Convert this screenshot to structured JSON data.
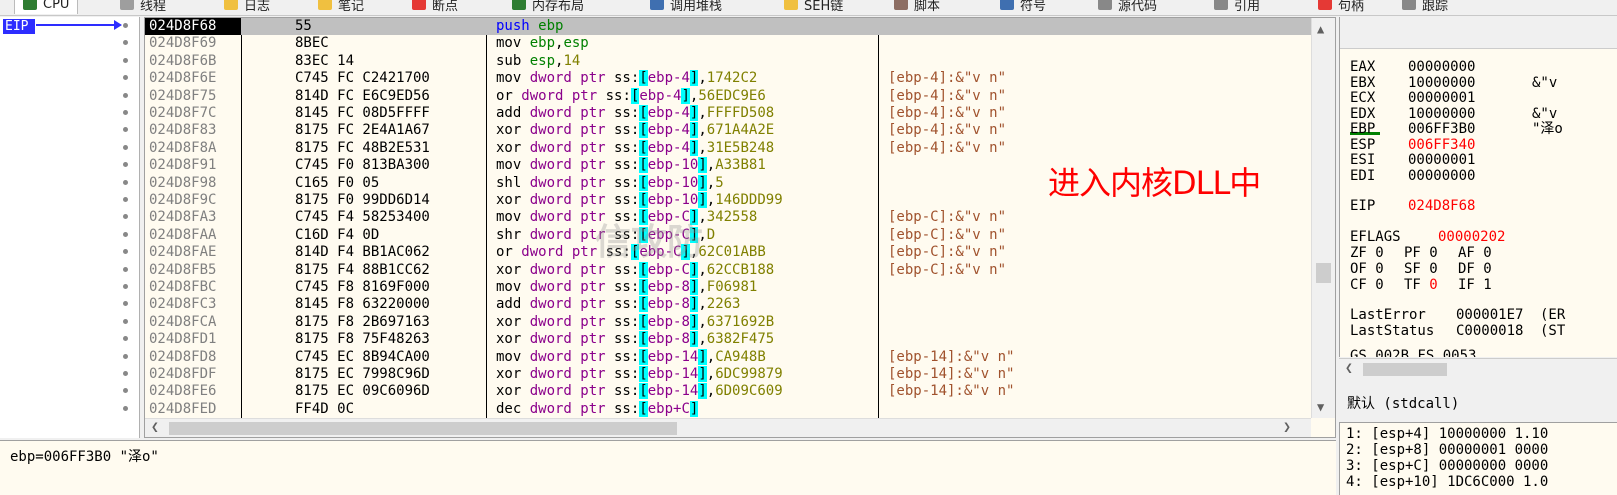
{
  "tabs": [
    {
      "label": "CPU",
      "active": true,
      "icon": "cpu-icon",
      "color": "#2e7d32"
    },
    {
      "label": "线程",
      "icon": "thread-icon",
      "color": "#9e9e9e"
    },
    {
      "label": "日志",
      "icon": "log-icon",
      "color": "#f0c040"
    },
    {
      "label": "笔记",
      "icon": "notes-icon",
      "color": "#f0c040"
    },
    {
      "label": "断点",
      "icon": "breakpoint-icon",
      "color": "#e53935"
    },
    {
      "label": "内存布局",
      "icon": "memory-map-icon",
      "color": "#2e7d32"
    },
    {
      "label": "调用堆栈",
      "icon": "call-stack-icon",
      "color": "#3f6fb0"
    },
    {
      "label": "SEH链",
      "icon": "seh-icon",
      "color": "#f0c040"
    },
    {
      "label": "脚本",
      "icon": "script-icon",
      "color": "#8d6e63"
    },
    {
      "label": "符号",
      "icon": "symbols-icon",
      "color": "#3f6fb0"
    },
    {
      "label": "源代码",
      "icon": "source-icon",
      "color": "#888888"
    },
    {
      "label": "引用",
      "icon": "references-icon",
      "color": "#888888"
    },
    {
      "label": "句柄",
      "icon": "handles-icon",
      "color": "#e53935"
    },
    {
      "label": "跟踪",
      "icon": "trace-icon",
      "color": "#888888"
    }
  ],
  "gutter": {
    "eip_label": "EIP"
  },
  "disasm": {
    "rows": [
      {
        "addr": "024D8F68",
        "bytes": "55",
        "ins": [
          [
            "push",
            "k-push"
          ],
          [
            " ",
            ""
          ],
          [
            "ebp",
            "k-reg"
          ]
        ],
        "comment": ""
      },
      {
        "addr": "024D8F69",
        "bytes": "8BEC",
        "ins": [
          [
            "mov ",
            ""
          ],
          [
            "ebp",
            "k-reg"
          ],
          [
            ",",
            ""
          ],
          [
            "esp",
            "k-reg"
          ]
        ],
        "comment": ""
      },
      {
        "addr": "024D8F6B",
        "bytes": "83EC 14",
        "ins": [
          [
            "sub ",
            ""
          ],
          [
            "esp",
            "k-reg"
          ],
          [
            ",",
            ""
          ],
          [
            "14",
            "k-num"
          ]
        ],
        "comment": ""
      },
      {
        "addr": "024D8F6E",
        "bytes": "C745 FC C2421700",
        "ins": [
          [
            "mov ",
            ""
          ],
          [
            "dword ptr",
            "k-ptr"
          ],
          [
            " ss:",
            ""
          ],
          [
            "[",
            "k-hl"
          ],
          [
            "ebp-4",
            "k-ptr"
          ],
          [
            "]",
            "k-hl"
          ],
          [
            ",",
            ""
          ],
          [
            "1742C2",
            "k-num"
          ]
        ],
        "comment": "[ebp-4]:&\"v n\""
      },
      {
        "addr": "024D8F75",
        "bytes": "814D FC E6C9ED56",
        "ins": [
          [
            "or ",
            ""
          ],
          [
            "dword ptr",
            "k-ptr"
          ],
          [
            " ss:",
            ""
          ],
          [
            "[",
            "k-hl"
          ],
          [
            "ebp-4",
            "k-ptr"
          ],
          [
            "]",
            "k-hl"
          ],
          [
            ",",
            ""
          ],
          [
            "56EDC9E6",
            "k-num"
          ]
        ],
        "comment": "[ebp-4]:&\"v n\""
      },
      {
        "addr": "024D8F7C",
        "bytes": "8145 FC 08D5FFFF",
        "ins": [
          [
            "add ",
            ""
          ],
          [
            "dword ptr",
            "k-ptr"
          ],
          [
            " ss:",
            ""
          ],
          [
            "[",
            "k-hl"
          ],
          [
            "ebp-4",
            "k-ptr"
          ],
          [
            "]",
            "k-hl"
          ],
          [
            ",",
            ""
          ],
          [
            "FFFFD508",
            "k-num"
          ]
        ],
        "comment": "[ebp-4]:&\"v n\""
      },
      {
        "addr": "024D8F83",
        "bytes": "8175 FC 2E4A1A67",
        "ins": [
          [
            "xor ",
            ""
          ],
          [
            "dword ptr",
            "k-ptr"
          ],
          [
            " ss:",
            ""
          ],
          [
            "[",
            "k-hl"
          ],
          [
            "ebp-4",
            "k-ptr"
          ],
          [
            "]",
            "k-hl"
          ],
          [
            ",",
            ""
          ],
          [
            "671A4A2E",
            "k-num"
          ]
        ],
        "comment": "[ebp-4]:&\"v n\""
      },
      {
        "addr": "024D8F8A",
        "bytes": "8175 FC 48B2E531",
        "ins": [
          [
            "xor ",
            ""
          ],
          [
            "dword ptr",
            "k-ptr"
          ],
          [
            " ss:",
            ""
          ],
          [
            "[",
            "k-hl"
          ],
          [
            "ebp-4",
            "k-ptr"
          ],
          [
            "]",
            "k-hl"
          ],
          [
            ",",
            ""
          ],
          [
            "31E5B248",
            "k-num"
          ]
        ],
        "comment": "[ebp-4]:&\"v n\""
      },
      {
        "addr": "024D8F91",
        "bytes": "C745 F0 813BA300",
        "ins": [
          [
            "mov ",
            ""
          ],
          [
            "dword ptr",
            "k-ptr"
          ],
          [
            " ss:",
            ""
          ],
          [
            "[",
            "k-hl"
          ],
          [
            "ebp-10",
            "k-ptr"
          ],
          [
            "]",
            "k-hl"
          ],
          [
            ",",
            ""
          ],
          [
            "A33B81",
            "k-num"
          ]
        ],
        "comment": ""
      },
      {
        "addr": "024D8F98",
        "bytes": "C165 F0 05",
        "ins": [
          [
            "shl ",
            ""
          ],
          [
            "dword ptr",
            "k-ptr"
          ],
          [
            " ss:",
            ""
          ],
          [
            "[",
            "k-hl"
          ],
          [
            "ebp-10",
            "k-ptr"
          ],
          [
            "]",
            "k-hl"
          ],
          [
            ",",
            ""
          ],
          [
            "5",
            "k-num"
          ]
        ],
        "comment": ""
      },
      {
        "addr": "024D8F9C",
        "bytes": "8175 F0 99DD6D14",
        "ins": [
          [
            "xor ",
            ""
          ],
          [
            "dword ptr",
            "k-ptr"
          ],
          [
            " ss:",
            ""
          ],
          [
            "[",
            "k-hl"
          ],
          [
            "ebp-10",
            "k-ptr"
          ],
          [
            "]",
            "k-hl"
          ],
          [
            ",",
            ""
          ],
          [
            "146DDD99",
            "k-num"
          ]
        ],
        "comment": ""
      },
      {
        "addr": "024D8FA3",
        "bytes": "C745 F4 58253400",
        "ins": [
          [
            "mov ",
            ""
          ],
          [
            "dword ptr",
            "k-ptr"
          ],
          [
            " ss:",
            ""
          ],
          [
            "[",
            "k-hl"
          ],
          [
            "ebp-C",
            "k-ptr"
          ],
          [
            "]",
            "k-hl"
          ],
          [
            ",",
            ""
          ],
          [
            "342558",
            "k-num"
          ]
        ],
        "comment": "[ebp-C]:&\"v n\""
      },
      {
        "addr": "024D8FAA",
        "bytes": "C16D F4 0D",
        "ins": [
          [
            "shr ",
            ""
          ],
          [
            "dword ptr",
            "k-ptr"
          ],
          [
            " ss:",
            ""
          ],
          [
            "[",
            "k-hl"
          ],
          [
            "ebp-C",
            "k-ptr"
          ],
          [
            "]",
            "k-hl"
          ],
          [
            ",",
            ""
          ],
          [
            "D",
            "k-num"
          ]
        ],
        "comment": "[ebp-C]:&\"v n\""
      },
      {
        "addr": "024D8FAE",
        "bytes": "814D F4 BB1AC062",
        "ins": [
          [
            "or ",
            ""
          ],
          [
            "dword ptr",
            "k-ptr"
          ],
          [
            " ss:",
            ""
          ],
          [
            "[",
            "k-hl"
          ],
          [
            "ebp-C",
            "k-ptr"
          ],
          [
            "]",
            "k-hl"
          ],
          [
            ",",
            ""
          ],
          [
            "62C01ABB",
            "k-num"
          ]
        ],
        "comment": "[ebp-C]:&\"v n\""
      },
      {
        "addr": "024D8FB5",
        "bytes": "8175 F4 88B1CC62",
        "ins": [
          [
            "xor ",
            ""
          ],
          [
            "dword ptr",
            "k-ptr"
          ],
          [
            " ss:",
            ""
          ],
          [
            "[",
            "k-hl"
          ],
          [
            "ebp-C",
            "k-ptr"
          ],
          [
            "]",
            "k-hl"
          ],
          [
            ",",
            ""
          ],
          [
            "62CCB188",
            "k-num"
          ]
        ],
        "comment": "[ebp-C]:&\"v n\""
      },
      {
        "addr": "024D8FBC",
        "bytes": "C745 F8 8169F000",
        "ins": [
          [
            "mov ",
            ""
          ],
          [
            "dword ptr",
            "k-ptr"
          ],
          [
            " ss:",
            ""
          ],
          [
            "[",
            "k-hl"
          ],
          [
            "ebp-8",
            "k-ptr"
          ],
          [
            "]",
            "k-hl"
          ],
          [
            ",",
            ""
          ],
          [
            "F06981",
            "k-num"
          ]
        ],
        "comment": ""
      },
      {
        "addr": "024D8FC3",
        "bytes": "8145 F8 63220000",
        "ins": [
          [
            "add ",
            ""
          ],
          [
            "dword ptr",
            "k-ptr"
          ],
          [
            " ss:",
            ""
          ],
          [
            "[",
            "k-hl"
          ],
          [
            "ebp-8",
            "k-ptr"
          ],
          [
            "]",
            "k-hl"
          ],
          [
            ",",
            ""
          ],
          [
            "2263",
            "k-num"
          ]
        ],
        "comment": ""
      },
      {
        "addr": "024D8FCA",
        "bytes": "8175 F8 2B697163",
        "ins": [
          [
            "xor ",
            ""
          ],
          [
            "dword ptr",
            "k-ptr"
          ],
          [
            " ss:",
            ""
          ],
          [
            "[",
            "k-hl"
          ],
          [
            "ebp-8",
            "k-ptr"
          ],
          [
            "]",
            "k-hl"
          ],
          [
            ",",
            ""
          ],
          [
            "6371692B",
            "k-num"
          ]
        ],
        "comment": ""
      },
      {
        "addr": "024D8FD1",
        "bytes": "8175 F8 75F48263",
        "ins": [
          [
            "xor ",
            ""
          ],
          [
            "dword ptr",
            "k-ptr"
          ],
          [
            " ss:",
            ""
          ],
          [
            "[",
            "k-hl"
          ],
          [
            "ebp-8",
            "k-ptr"
          ],
          [
            "]",
            "k-hl"
          ],
          [
            ",",
            ""
          ],
          [
            "6382F475",
            "k-num"
          ]
        ],
        "comment": ""
      },
      {
        "addr": "024D8FD8",
        "bytes": "C745 EC 8B94CA00",
        "ins": [
          [
            "mov ",
            ""
          ],
          [
            "dword ptr",
            "k-ptr"
          ],
          [
            " ss:",
            ""
          ],
          [
            "[",
            "k-hl"
          ],
          [
            "ebp-14",
            "k-ptr"
          ],
          [
            "]",
            "k-hl"
          ],
          [
            ",",
            ""
          ],
          [
            "CA948B",
            "k-num"
          ]
        ],
        "comment": "[ebp-14]:&\"v n\""
      },
      {
        "addr": "024D8FDF",
        "bytes": "8175 EC 7998C96D",
        "ins": [
          [
            "xor ",
            ""
          ],
          [
            "dword ptr",
            "k-ptr"
          ],
          [
            " ss:",
            ""
          ],
          [
            "[",
            "k-hl"
          ],
          [
            "ebp-14",
            "k-ptr"
          ],
          [
            "]",
            "k-hl"
          ],
          [
            ",",
            ""
          ],
          [
            "6DC99879",
            "k-num"
          ]
        ],
        "comment": "[ebp-14]:&\"v n\""
      },
      {
        "addr": "024D8FE6",
        "bytes": "8175 EC 09C6096D",
        "ins": [
          [
            "xor ",
            ""
          ],
          [
            "dword ptr",
            "k-ptr"
          ],
          [
            " ss:",
            ""
          ],
          [
            "[",
            "k-hl"
          ],
          [
            "ebp-14",
            "k-ptr"
          ],
          [
            "]",
            "k-hl"
          ],
          [
            ",",
            ""
          ],
          [
            "6D09C609",
            "k-num"
          ]
        ],
        "comment": "[ebp-14]:&\"v n\""
      },
      {
        "addr": "024D8FED",
        "bytes": "FF4D 0C",
        "ins": [
          [
            "dec ",
            ""
          ],
          [
            "dword ptr",
            "k-ptr"
          ],
          [
            " ss:",
            ""
          ],
          [
            "[",
            "k-hl"
          ],
          [
            "ebp+C",
            "k-ptr"
          ],
          [
            "]",
            "k-hl"
          ]
        ],
        "comment": ""
      }
    ]
  },
  "annotation": "进入内核DLL中",
  "watermark": "信攻防",
  "info_line": "ebp=006FF3B0 \"泽o\"",
  "registers": {
    "general": [
      {
        "name": "EAX",
        "value": "00000000",
        "extra": "",
        "red": false
      },
      {
        "name": "EBX",
        "value": "10000000",
        "extra": "&\"v",
        "red": false
      },
      {
        "name": "ECX",
        "value": "00000001",
        "extra": "",
        "red": false
      },
      {
        "name": "EDX",
        "value": "10000000",
        "extra": "&\"v",
        "red": false
      },
      {
        "name": "EBP",
        "value": "006FF3B0",
        "extra": "\"泽o",
        "red": false
      },
      {
        "name": "ESP",
        "value": "006FF340",
        "extra": "",
        "red": true
      },
      {
        "name": "ESI",
        "value": "00000001",
        "extra": "",
        "red": false
      },
      {
        "name": "EDI",
        "value": "00000000",
        "extra": "",
        "red": false
      }
    ],
    "eip": {
      "name": "EIP",
      "value": "024D8F68"
    },
    "eflags": {
      "name": "EFLAGS",
      "value": "00000202"
    },
    "flags": [
      [
        {
          "n": "ZF",
          "v": "0"
        },
        {
          "n": "PF",
          "v": "0"
        },
        {
          "n": "AF",
          "v": "0"
        }
      ],
      [
        {
          "n": "OF",
          "v": "0"
        },
        {
          "n": "SF",
          "v": "0"
        },
        {
          "n": "DF",
          "v": "0"
        }
      ],
      [
        {
          "n": "CF",
          "v": "0"
        },
        {
          "n": "TF",
          "v": "0",
          "red": true
        },
        {
          "n": "IF",
          "v": "1"
        }
      ]
    ],
    "last_error": {
      "name": "LastError",
      "value": "000001E7",
      "extra": "(ER"
    },
    "last_status": {
      "name": "LastStatus",
      "value": "C0000018",
      "extra": "(ST"
    },
    "partial": "GS 002B  FS 0053"
  },
  "call_convention": "默认 (stdcall)",
  "stack_args": [
    "1: [esp+4] 10000000 1.10",
    "2: [esp+8] 00000001 0000",
    "3: [esp+C] 00000000 0000",
    "4: [esp+10] 1DC6C000 1.0"
  ]
}
